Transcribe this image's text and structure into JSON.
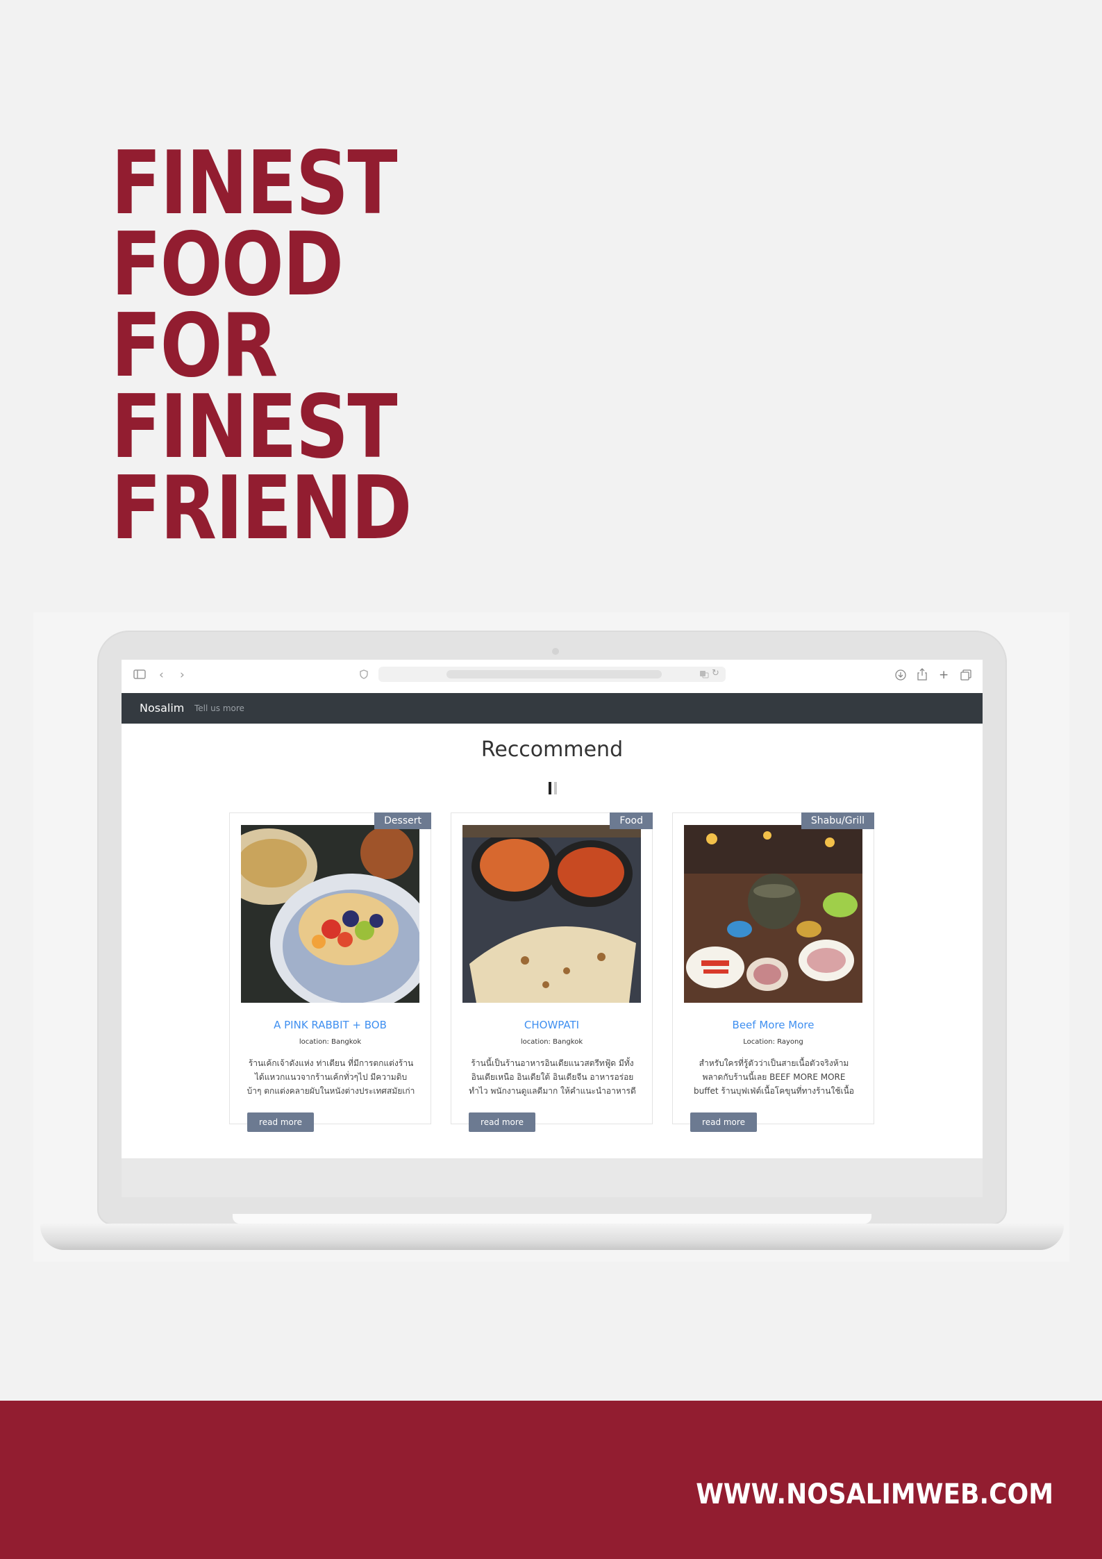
{
  "headline": {
    "lines": [
      "FINEST",
      "FOOD",
      "FOR",
      "FINEST",
      "FRIEND"
    ]
  },
  "brand_color": "#921d30",
  "browser": {
    "icons": [
      "sidebar-icon",
      "back-icon",
      "forward-icon",
      "shield-icon",
      "translate-icon",
      "reload-icon",
      "download-icon",
      "share-icon",
      "new-tab-icon",
      "tabs-overview-icon"
    ]
  },
  "site": {
    "brand": "Nosalim",
    "nav_link": "Tell us more",
    "section_title": "Reccommend",
    "cards": [
      {
        "badge": "Dessert",
        "title": "A PINK RABBIT + BOB",
        "location": "location: Bangkok",
        "description": "ร้านเค้กเจ้าดังแห่ง ท่าเตียน ที่มีการตกแต่งร้านได้แหวกแนวจากร้านเค้กทั่วๆไป มีความดิบ บ้าๆ ตกแต่งคลายผับในหนังต่างประเทศสมัยเก่า",
        "button": "read more"
      },
      {
        "badge": "Food",
        "title": "CHOWPATI",
        "location": "location: Bangkok",
        "description": "ร้านนี้เป็นร้านอาหารอินเดียแนวสตรีทฟู้ด มีทั้งอินเดียเหนือ อินเดียใต้ อินเดียจีน อาหารอร่อย ทำไว พนักงานดูแลดีมาก ให้คำแนะนำอาหารดี",
        "button": "read more"
      },
      {
        "badge": "Shabu/Grill",
        "title": "Beef More More",
        "location": "Location: Rayong",
        "description": "สำหรับใครที่รู้ตัวว่าเป็นสายเนื้อตัวจริงห้ามพลาดกับร้านนี้เลย BEEF MORE MORE buffet ร้านบุฟเฟ่ต์เนื้อโคขุนที่ทางร้านใช้เนื้ออย่างดี",
        "button": "read more"
      }
    ]
  },
  "website": "WWW.NOSALIMWEB.COM"
}
